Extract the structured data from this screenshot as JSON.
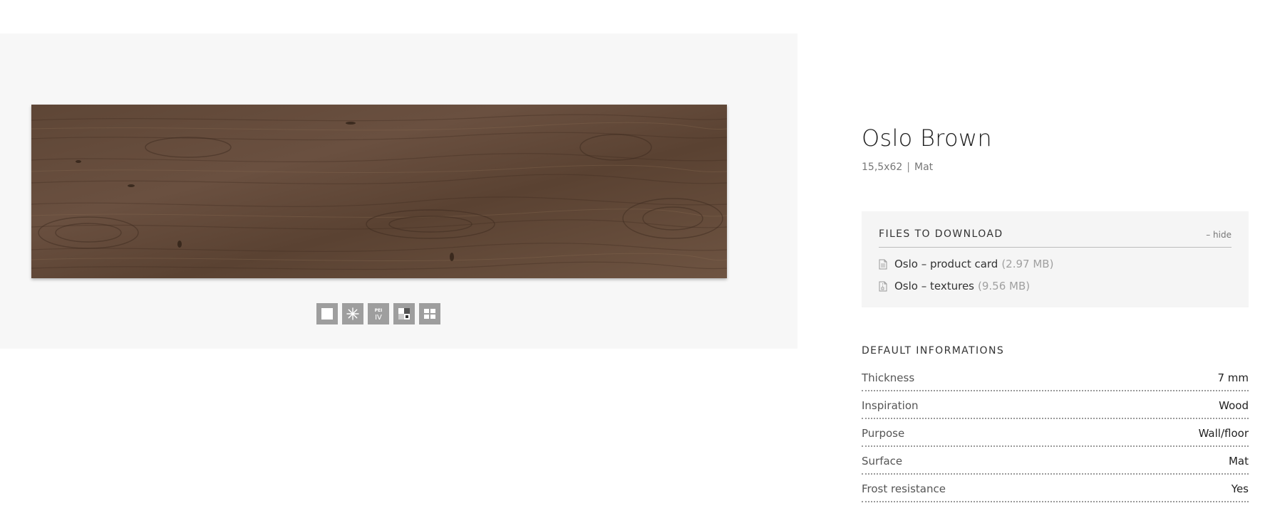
{
  "product": {
    "name": "Oslo Brown",
    "size": "15,5x62",
    "separator": "|",
    "finish": "Mat"
  },
  "gallery": {
    "tile_colors": [
      "#5a4433",
      "#6b5240",
      "#4a3628",
      "#7a5e48"
    ],
    "icons": [
      {
        "name": "single-tile-icon"
      },
      {
        "name": "frost-resistant-icon"
      },
      {
        "name": "pei-rating-icon",
        "label_top": "PEI",
        "label_bottom": "IV"
      },
      {
        "name": "shade-variation-icon"
      },
      {
        "name": "arrangement-icon"
      }
    ]
  },
  "downloads": {
    "title": "FILES TO DOWNLOAD",
    "hide_label": "– hide",
    "files": [
      {
        "name": "Oslo – product card",
        "size": "(2.97 MB)",
        "icon": "document-icon"
      },
      {
        "name": "Oslo – textures",
        "size": "(9.56 MB)",
        "icon": "archive-icon"
      }
    ]
  },
  "default_info": {
    "title": "DEFAULT INFORMATIONS",
    "rows": [
      {
        "label": "Thickness",
        "value": "7 mm"
      },
      {
        "label": "Inspiration",
        "value": "Wood"
      },
      {
        "label": "Purpose",
        "value": "Wall/floor"
      },
      {
        "label": "Surface",
        "value": "Mat"
      },
      {
        "label": "Frost resistance",
        "value": "Yes"
      }
    ]
  }
}
